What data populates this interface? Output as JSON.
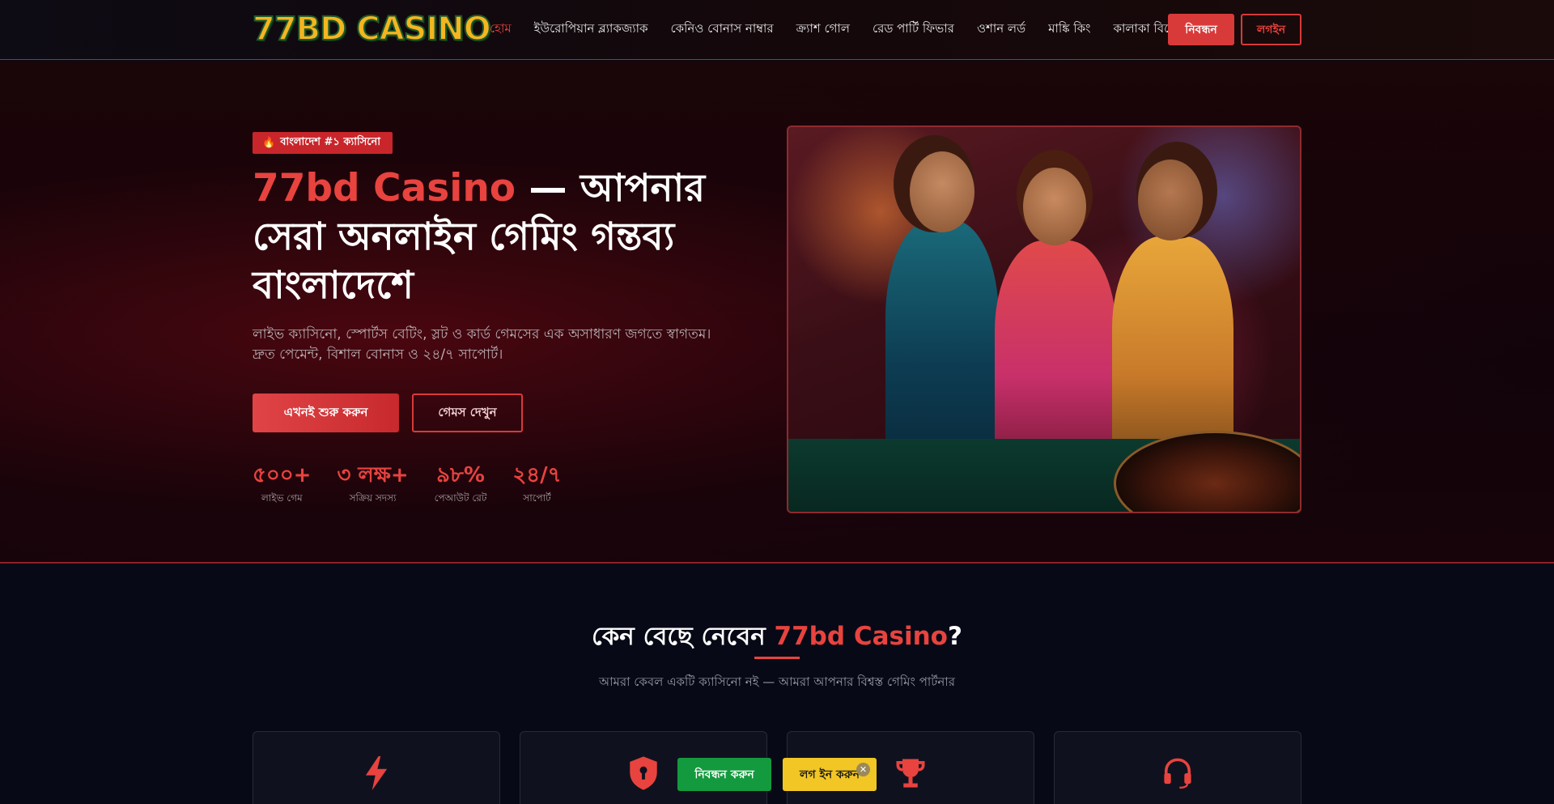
{
  "header": {
    "logo_text": "77BD CASINO",
    "nav": [
      {
        "label": "হোম",
        "active": true
      },
      {
        "label": "ইউরোপিয়ান ব্ল্যাকজ্যাক"
      },
      {
        "label": "কেনিও বোনাস নাম্বার"
      },
      {
        "label": "ক্র্যাশ গোল"
      },
      {
        "label": "রেড পার্টি ফিভার"
      },
      {
        "label": "ওশান লর্ড"
      },
      {
        "label": "মাঙ্কি কিং"
      },
      {
        "label": "কালাকা বিঙ্গো"
      }
    ],
    "register_label": "নিবন্ধন",
    "login_label": "লগইন"
  },
  "hero": {
    "badge_icon": "fire-icon",
    "badge_text": "বাংলাদেশ #১ ক্যাসিনো",
    "title_accent": "77bd Casino",
    "title_rest": " — আপনার সেরা অনলাইন গেমিং গন্তব্য বাংলাদেশে",
    "subtitle_line1": "লাইভ ক্যাসিনো, স্পোর্টস বেটিং, স্লট ও কার্ড গেমসের এক অসাধারণ জগতে স্বাগতম।",
    "subtitle_line2": "দ্রুত পেমেন্ট, বিশাল বোনাস ও ২৪/৭ সাপোর্ট।",
    "start_button": "এখনই শুরু করুন",
    "games_button": "গেমস দেখুন",
    "stats": [
      {
        "value": "৫০০+",
        "label": "লাইভ গেম"
      },
      {
        "value": "৩ লক্ষ+",
        "label": "সক্রিয় সদস্য"
      },
      {
        "value": "৯৮%",
        "label": "পেআউট রেট"
      },
      {
        "value": "২৪/৭",
        "label": "সাপোর্ট"
      }
    ]
  },
  "why": {
    "title_prefix": "কেন বেছে নেবেন ",
    "title_accent": "77bd Casino",
    "title_suffix": "?",
    "subtitle": "আমরা কেবল একটি ক্যাসিনো নই — আমরা আপনার বিশ্বস্ত গেমিং পার্টনার",
    "cards": [
      {
        "icon": "lightning-icon"
      },
      {
        "icon": "shield-icon"
      },
      {
        "icon": "trophy-icon"
      },
      {
        "icon": "headset-icon"
      }
    ]
  },
  "floating": {
    "register_label": "নিবন্ধন করুন",
    "login_label": "লগ ইন করুন",
    "close_icon": "close-icon"
  },
  "colors": {
    "accent": "#e8433f",
    "register_green": "#149a3e",
    "login_yellow": "#f2c624",
    "background": "#070a16"
  }
}
